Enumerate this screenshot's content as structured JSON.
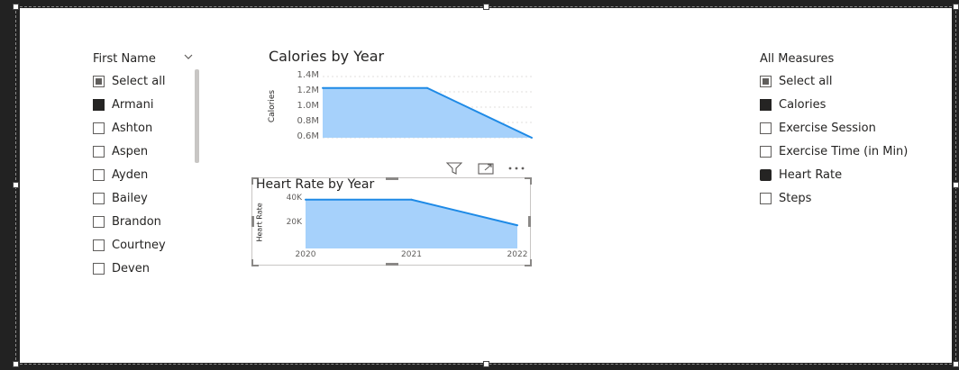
{
  "first_name_slicer": {
    "title": "First Name",
    "items": [
      {
        "label": "Select all",
        "state": "partial"
      },
      {
        "label": "Armani",
        "state": "checked"
      },
      {
        "label": "Ashton",
        "state": "unchecked"
      },
      {
        "label": "Aspen",
        "state": "unchecked"
      },
      {
        "label": "Ayden",
        "state": "unchecked"
      },
      {
        "label": "Bailey",
        "state": "unchecked"
      },
      {
        "label": "Brandon",
        "state": "unchecked"
      },
      {
        "label": "Courtney",
        "state": "unchecked"
      },
      {
        "label": "Deven",
        "state": "unchecked"
      }
    ]
  },
  "measures_slicer": {
    "title": "All Measures",
    "items": [
      {
        "label": "Select all",
        "state": "partial"
      },
      {
        "label": "Calories",
        "state": "checked"
      },
      {
        "label": "Exercise Session",
        "state": "unchecked"
      },
      {
        "label": "Exercise Time (in Min)",
        "state": "unchecked"
      },
      {
        "label": "Heart Rate",
        "state": "cursor"
      },
      {
        "label": "Steps",
        "state": "unchecked"
      }
    ]
  },
  "visual_header": {
    "icons": [
      "filter-icon",
      "focus-mode-icon",
      "more-options-icon"
    ]
  },
  "colors": {
    "area_fill": "#a6d1fb",
    "area_line": "#1e8ae6",
    "gridline": "#e1dfdd"
  },
  "chart_data": [
    {
      "type": "area",
      "title": "Calories by Year",
      "ylabel": "Calories",
      "xlabel": "",
      "x": [
        "2020",
        "2021",
        "2022"
      ],
      "values": [
        1250000,
        1250000,
        600000
      ],
      "ylim": [
        600000,
        1400000
      ],
      "yticks": [
        "1.4M",
        "1.2M",
        "1.0M",
        "0.8M",
        "0.6M"
      ],
      "yticks_values": [
        1400000,
        1200000,
        1000000,
        800000,
        600000
      ],
      "xticks_visible": false,
      "grid": true
    },
    {
      "type": "area",
      "title": "Heart Rate by Year",
      "ylabel": "Heart Rate",
      "xlabel": "",
      "x": [
        "2020",
        "2021",
        "2022"
      ],
      "values": [
        40000,
        40000,
        19000
      ],
      "ylim": [
        0,
        45000
      ],
      "yticks": [
        "40K",
        "20K"
      ],
      "yticks_values": [
        40000,
        20000
      ],
      "xticks_visible": true,
      "grid": false
    }
  ]
}
